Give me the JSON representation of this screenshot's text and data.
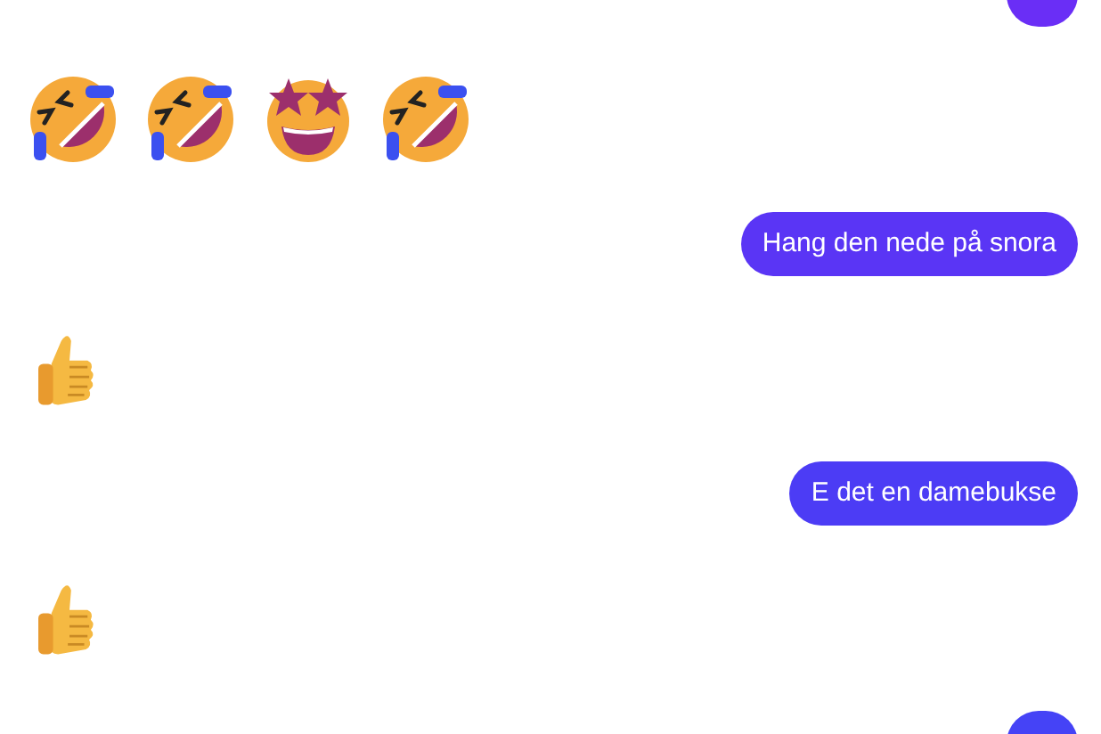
{
  "messages": [
    {
      "kind": "sent",
      "color": "#6a2ef6"
    },
    {
      "kind": "emoji-row",
      "emojis": [
        {
          "kind": "laughing"
        },
        {
          "kind": "laughing"
        },
        {
          "kind": "star-struck"
        },
        {
          "kind": "laughing"
        }
      ]
    },
    {
      "kind": "sent",
      "text": "Hang den nede på snora",
      "color": "#5a35f5"
    },
    {
      "kind": "emoji-row",
      "emojis": [
        {
          "kind": "thumbs-up"
        }
      ]
    },
    {
      "kind": "sent",
      "text": "E det en damebukse",
      "color": "#4c3cf5"
    },
    {
      "kind": "emoji-row",
      "emojis": [
        {
          "kind": "thumbs-up"
        }
      ]
    },
    {
      "kind": "sent",
      "color": "#4543f6"
    }
  ]
}
